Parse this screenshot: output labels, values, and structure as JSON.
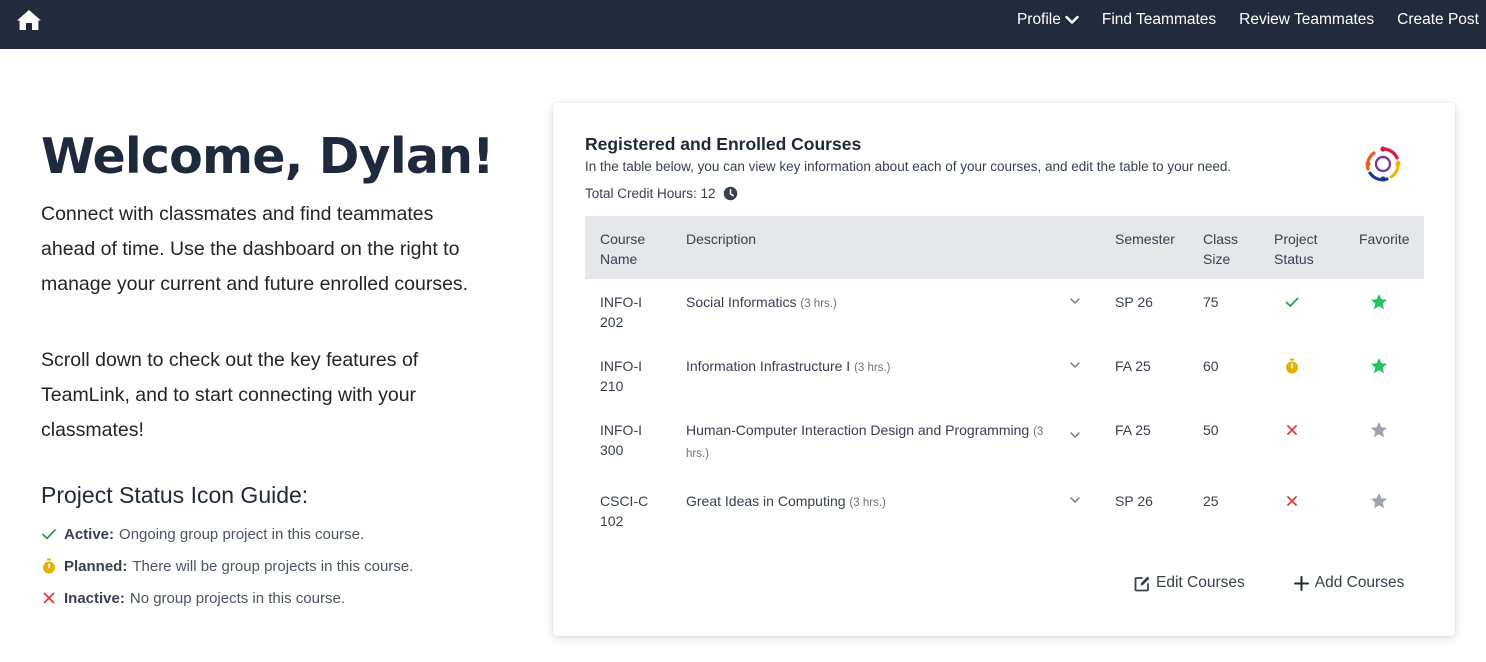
{
  "nav": {
    "home_icon": "home-icon",
    "links": [
      {
        "label": "Profile",
        "has_dropdown": true
      },
      {
        "label": "Find Teammates"
      },
      {
        "label": "Review Teammates"
      },
      {
        "label": "Create Post"
      }
    ]
  },
  "welcome": {
    "title": "Welcome, Dylan!",
    "paragraph1": "Connect with classmates and find teammates ahead of time. Use the dashboard on the right to manage your current and future enrolled courses.",
    "paragraph2": "Scroll down to check out the key features of TeamLink, and to start connecting with your classmates!"
  },
  "guide": {
    "title": "Project Status Icon Guide:",
    "items": [
      {
        "icon": "check-icon",
        "label": "Active:",
        "text": "Ongoing group project in this course."
      },
      {
        "icon": "stopwatch-icon",
        "label": "Planned:",
        "text": "There will be group projects in this course."
      },
      {
        "icon": "x-icon",
        "label": "Inactive:",
        "text": "No group projects in this course."
      }
    ]
  },
  "card": {
    "title": "Registered and Enrolled Courses",
    "subtitle": "In the table below, you can view key information about each of your courses, and edit the table to your need.",
    "credits": "Total Credit Hours: 12",
    "headers": {
      "name": "Course Name",
      "description": "Description",
      "semester": "Semester",
      "size": "Class Size",
      "status": "Project Status",
      "favorite": "Favorite"
    },
    "rows": [
      {
        "name": "INFO-I 202",
        "description": "Social Informatics",
        "hours": "(3 hrs.)",
        "semester": "SP 26",
        "size": "75",
        "status": "active",
        "favorite": true
      },
      {
        "name": "INFO-I 210",
        "description": "Information Infrastructure I",
        "hours": "(3 hrs.)",
        "semester": "FA 25",
        "size": "60",
        "status": "planned",
        "favorite": true
      },
      {
        "name": "INFO-I 300",
        "description": "Human-Computer Interaction Design and Programming",
        "hours": "(3 hrs.)",
        "semester": "FA 25",
        "size": "50",
        "status": "inactive",
        "favorite": false
      },
      {
        "name": "CSCI-C 102",
        "description": "Great Ideas in Computing",
        "hours": "(3 hrs.)",
        "semester": "SP 26",
        "size": "25",
        "status": "inactive",
        "favorite": false
      }
    ],
    "edit_label": "Edit Courses",
    "add_label": "Add Courses"
  },
  "colors": {
    "navbar": "#212b3b",
    "active": "#22a14b",
    "planned": "#e3b109",
    "inactive": "#e23b3b",
    "fav_on": "#22c55e",
    "fav_off": "#9ca3af"
  }
}
